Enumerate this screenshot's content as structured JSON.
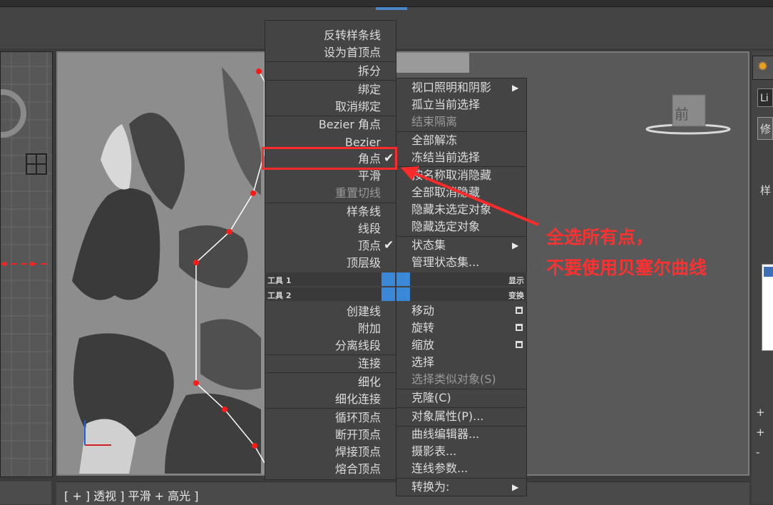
{
  "colors": {
    "accent_blue": "#3c88d8",
    "annotation_red": "#ff3030",
    "menu_bg": "#444444"
  },
  "menu_left": {
    "items": [
      {
        "label": "反转样条线",
        "dim": false
      },
      {
        "label": "设为首顶点",
        "dim": false
      },
      {
        "label": "拆分",
        "dim": false
      },
      {
        "label": "绑定",
        "dim": false
      },
      {
        "label": "取消绑定",
        "dim": false
      },
      {
        "label": "Bezier 角点",
        "dim": false
      },
      {
        "label": "Bezier",
        "dim": false
      },
      {
        "label": "角点",
        "dim": false,
        "checked": true
      },
      {
        "label": "平滑",
        "dim": false
      },
      {
        "label": "重置切线",
        "dim": true
      },
      {
        "label": "样条线",
        "dim": false
      },
      {
        "label": "线段",
        "dim": false
      },
      {
        "label": "顶点",
        "dim": false,
        "checked": true
      },
      {
        "label": "顶层级",
        "dim": false
      },
      {
        "label": "创建线",
        "dim": false
      },
      {
        "label": "附加",
        "dim": false
      },
      {
        "label": "分离线段",
        "dim": false
      },
      {
        "label": "连接",
        "dim": false
      },
      {
        "label": "细化",
        "dim": false
      },
      {
        "label": "细化连接",
        "dim": false
      },
      {
        "label": "循环顶点",
        "dim": false
      },
      {
        "label": "断开顶点",
        "dim": false
      },
      {
        "label": "焊接顶点",
        "dim": false
      },
      {
        "label": "熔合顶点",
        "dim": false
      }
    ],
    "tools": [
      "工具 1",
      "工具 2"
    ]
  },
  "menu_right": {
    "items": [
      {
        "label": "视口照明和阴影",
        "submenu": true
      },
      {
        "label": "孤立当前选择"
      },
      {
        "label": "结束隔离",
        "dim": true
      },
      {
        "label": "全部解冻"
      },
      {
        "label": "冻结当前选择"
      },
      {
        "label": "按名称取消隐藏"
      },
      {
        "label": "全部取消隐藏"
      },
      {
        "label": "隐藏未选定对象"
      },
      {
        "label": "隐藏选定对象"
      },
      {
        "label": "状态集",
        "submenu": true
      },
      {
        "label": "管理状态集..."
      },
      {
        "label": "移动",
        "box": true
      },
      {
        "label": "旋转",
        "box": true
      },
      {
        "label": "缩放",
        "box": true
      },
      {
        "label": "选择"
      },
      {
        "label": "选择类似对象(S)",
        "dim": true
      },
      {
        "label": "克隆(C)"
      },
      {
        "label": "对象属性(P)..."
      },
      {
        "label": "曲线编辑器..."
      },
      {
        "label": "摄影表..."
      },
      {
        "label": "连线参数..."
      },
      {
        "label": "转换为:",
        "submenu": true
      }
    ],
    "quad_labels": [
      "显示",
      "变换"
    ]
  },
  "annotation": {
    "line1": "全选所有点，",
    "line2": "不要使用贝塞尔曲线"
  },
  "viewport": {
    "label": "[ + ] 透视 ] 平滑 + 高光 ]",
    "viewcube": "前"
  },
  "right_panel": {
    "tab1": "Li",
    "tab2": "修",
    "tab3": "样"
  }
}
